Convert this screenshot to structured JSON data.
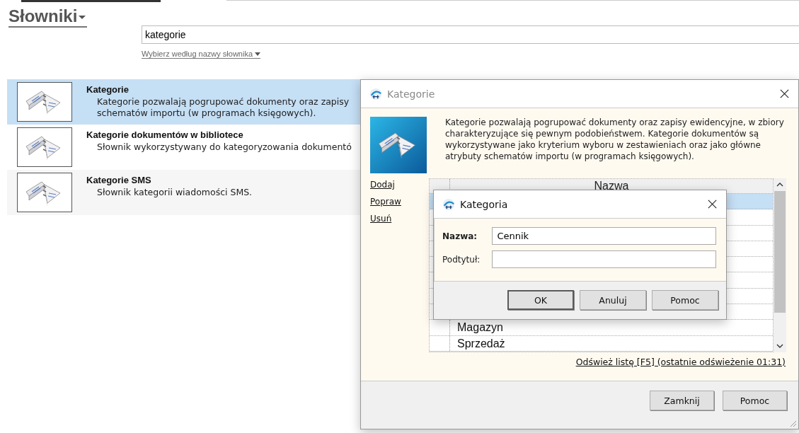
{
  "page": {
    "title": "Słowniki",
    "search": {
      "value": "kategorie"
    },
    "filter_link": "Wybierz według nazwy słownika",
    "dictionaries": [
      {
        "name": "Kategorie",
        "description": [
          "Kategorie pozwalają pogrupować dokumenty oraz zapisy",
          "schematów importu (w programach księgowych)."
        ],
        "selected": true
      },
      {
        "name": "Kategorie dokumentów w bibliotece",
        "description": [
          "Słownik wykorzystywany do kategoryzowania dokumentó"
        ],
        "selected": false
      },
      {
        "name": "Kategorie SMS",
        "description": [
          "Słownik kategorii wiadomości SMS."
        ],
        "selected": false
      }
    ]
  },
  "categories_window": {
    "title": "Kategorie",
    "active": false,
    "description": "Kategorie pozwalają pogrupować dokumenty oraz zapisy ewidencyjne, w zbiory charakteryzujące się pewnym podobieństwem. Kategorie dokumentów są wykorzystywane jako kryterium wyboru w zestawieniach oraz jako główne atrybuty schematów importu (w programach księgowych).",
    "actions": [
      "Dodaj",
      "Popraw",
      "Usuń"
    ],
    "grid": {
      "column": "Nazwa",
      "rows": [
        {
          "selected": true
        },
        {
          "selected": false
        },
        {
          "selected": false
        },
        {
          "selected": false
        },
        {
          "selected": false
        },
        {
          "selected": false
        },
        {
          "selected": false
        },
        {
          "selected": false
        },
        {
          "name": "Magazyn",
          "selected": false
        },
        {
          "name": "Sprzedaż",
          "selected": false
        }
      ]
    },
    "refresh_link": "Odśwież listę [F5] (ostatnie odświeżenie 01:31)",
    "buttons": [
      {
        "label": "Zamknij",
        "default": false
      },
      {
        "label": "Pomoc",
        "default": false
      }
    ]
  },
  "category_dialog": {
    "title": "Kategoria",
    "active": true,
    "fields": [
      {
        "label": "Nazwa:",
        "value": "Cennik",
        "required": true
      },
      {
        "label": "Podtytuł:",
        "required": false
      }
    ],
    "buttons": [
      {
        "label": "OK",
        "default": true
      },
      {
        "label": "Anuluj",
        "default": false
      },
      {
        "label": "Pomoc",
        "default": false
      }
    ]
  }
}
